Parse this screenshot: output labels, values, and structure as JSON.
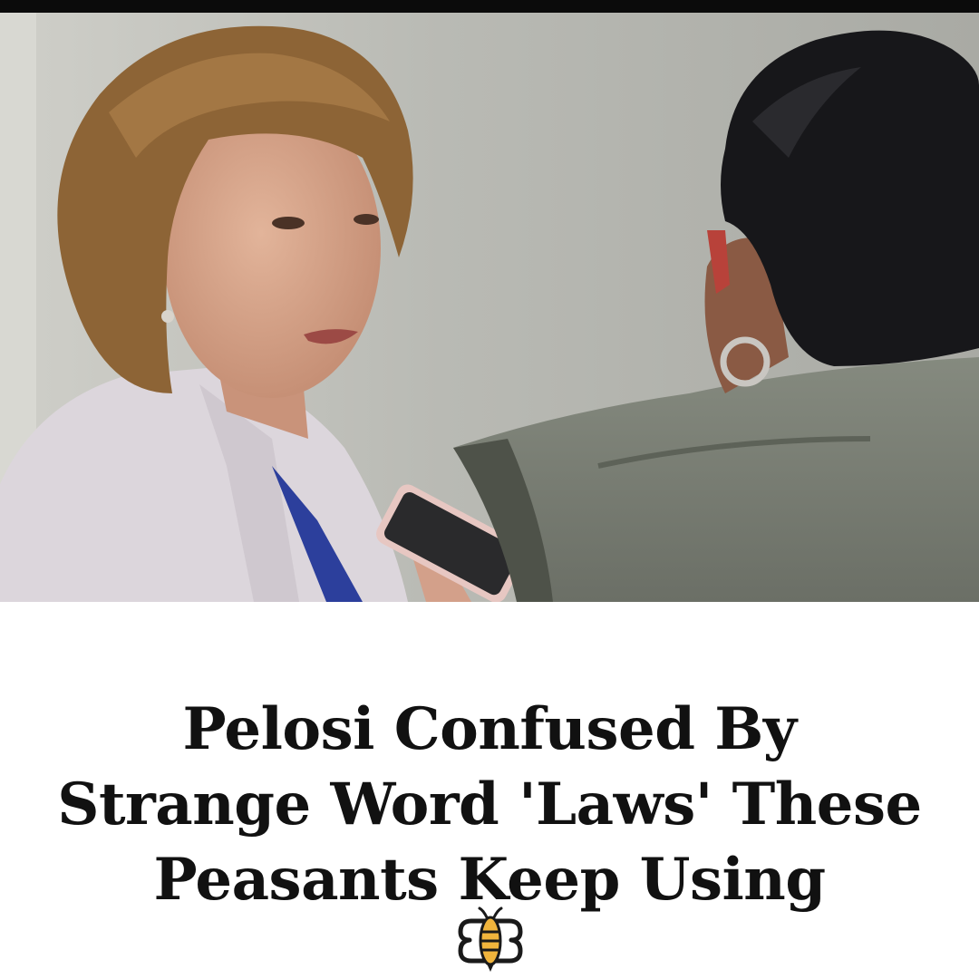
{
  "post": {
    "headline_lines": [
      "Pelosi Confused By",
      "Strange Word 'Laws' These",
      "Peasants Keep Using"
    ],
    "photo_description_icon": "news-photo",
    "logo_icon": "bee-logo-icon"
  },
  "colors": {
    "top_bar": "#0b0b0b",
    "background": "#ffffff",
    "headline_text": "#111111",
    "logo_yellow": "#f0b43c",
    "logo_dark": "#1a1a1a"
  }
}
